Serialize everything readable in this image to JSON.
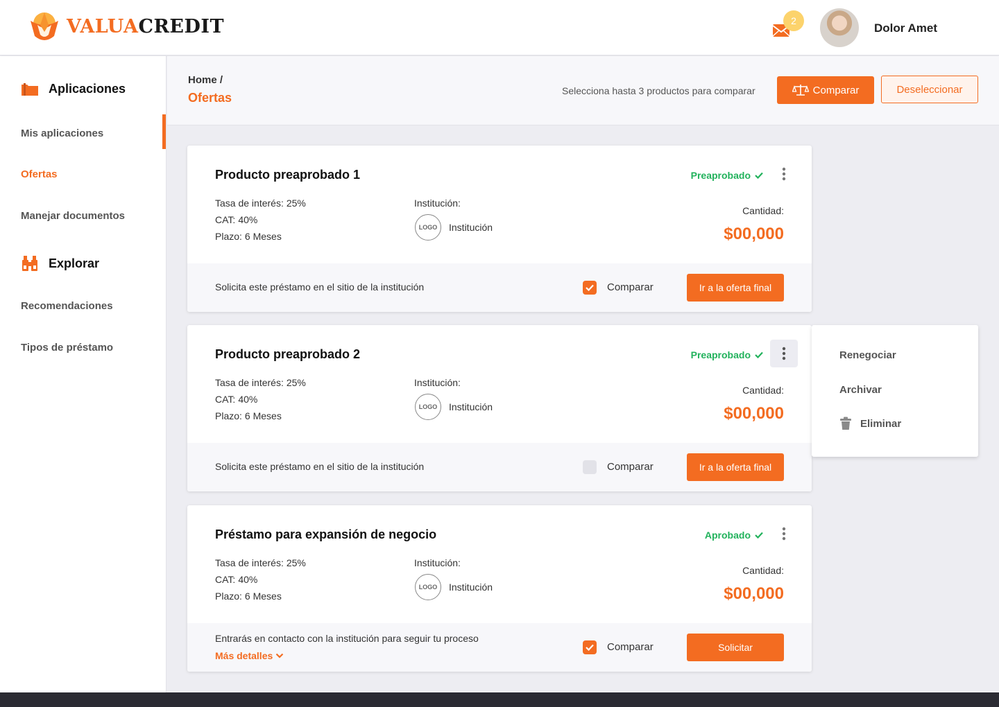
{
  "brand": {
    "part1": "Valua",
    "part2": "Credit",
    "colors": {
      "accent": "#f36c21",
      "approved": "#22b25c",
      "badge": "#fcd36c"
    }
  },
  "header": {
    "notifications_count": "2",
    "user_name": "Dolor Amet"
  },
  "sidebar": {
    "sections": [
      {
        "title": "Aplicaciones",
        "icon": "folder-icon",
        "items": [
          "Mis aplicaciones",
          "Ofertas",
          "Manejar documentos"
        ]
      },
      {
        "title": "Explorar",
        "icon": "binoculars-icon",
        "items": [
          "Recomendaciones",
          "Tipos de préstamo"
        ]
      }
    ],
    "active_item": "Ofertas"
  },
  "breadcrumb": {
    "home": "Home /",
    "current": "Ofertas"
  },
  "toolbar": {
    "hint": "Selecciona hasta 3 productos para comparar",
    "compare_label": "Comparar",
    "deselect_label": "Deseleccionar"
  },
  "offers": [
    {
      "title": "Producto preaprobado 1",
      "status": "Preaprobado",
      "rate_label": "Tasa de interés:",
      "rate": "25%",
      "cat_label": "CAT:",
      "cat": "40%",
      "term_label": "Plazo:",
      "term": "6 Meses",
      "institution_label": "Institución:",
      "logo_text": "LOGO",
      "institution": "Institución",
      "amount_label": "Cantidad:",
      "amount": "$00,000",
      "footer_text": "Solicita este préstamo en el sitio de la institución",
      "compare_label": "Comparar",
      "compare_checked": true,
      "action_label": "Ir a la oferta final"
    },
    {
      "title": "Producto preaprobado 2",
      "status": "Preaprobado",
      "rate_label": "Tasa de interés:",
      "rate": "25%",
      "cat_label": "CAT:",
      "cat": "40%",
      "term_label": "Plazo:",
      "term": "6 Meses",
      "institution_label": "Institución:",
      "logo_text": "LOGO",
      "institution": "Institución",
      "amount_label": "Cantidad:",
      "amount": "$00,000",
      "footer_text": "Solicita este préstamo en el sitio de la institución",
      "compare_label": "Comparar",
      "compare_checked": false,
      "action_label": "Ir a la oferta final"
    },
    {
      "title": "Préstamo para expansión de negocio",
      "status": "Aprobado",
      "rate_label": "Tasa de interés:",
      "rate": "25%",
      "cat_label": "CAT:",
      "cat": "40%",
      "term_label": "Plazo:",
      "term": "6 Meses",
      "institution_label": "Institución:",
      "logo_text": "LOGO",
      "institution": "Institución",
      "amount_label": "Cantidad:",
      "amount": "$00,000",
      "footer_text": "Entrarás en contacto con la institución para seguir tu proceso",
      "more_label": "Más detalles",
      "compare_label": "Comparar",
      "compare_checked": true,
      "action_label": "Solicitar"
    }
  ],
  "context_menu": {
    "items": [
      "Renegociar",
      "Archivar",
      "Eliminar"
    ]
  }
}
